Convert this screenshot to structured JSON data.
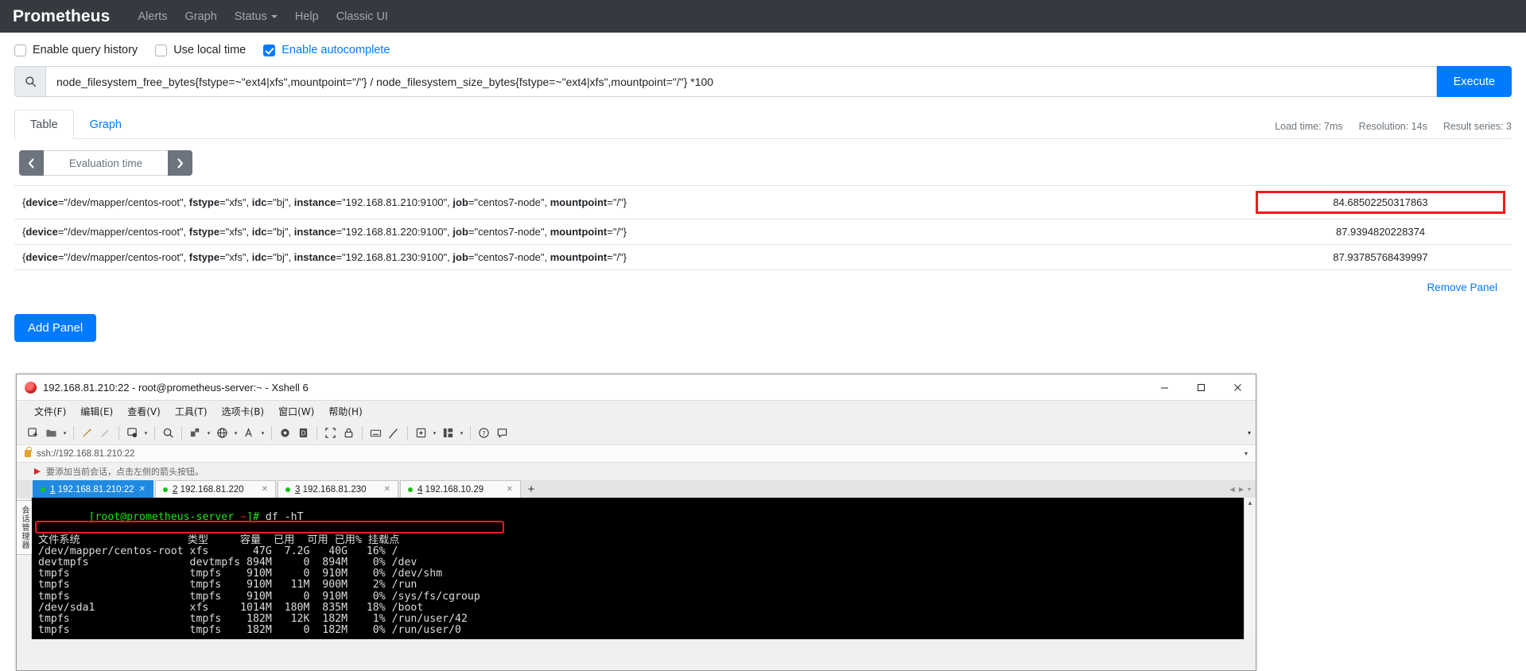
{
  "navbar": {
    "brand": "Prometheus",
    "links": [
      {
        "label": "Alerts"
      },
      {
        "label": "Graph"
      },
      {
        "label": "Status",
        "caret": true
      },
      {
        "label": "Help"
      },
      {
        "label": "Classic UI"
      }
    ]
  },
  "options": [
    {
      "label": "Enable query history",
      "checked": false
    },
    {
      "label": "Use local time",
      "checked": false
    },
    {
      "label": "Enable autocomplete",
      "checked": true
    }
  ],
  "query": {
    "icon": "search-icon",
    "expression": "node_filesystem_free_bytes{fstype=~\"ext4|xfs\",mountpoint=\"/\"} / node_filesystem_size_bytes{fstype=~\"ext4|xfs\",mountpoint=\"/\"} *100",
    "execute_label": "Execute"
  },
  "tabs": [
    {
      "label": "Table",
      "active": true
    },
    {
      "label": "Graph",
      "active": false
    }
  ],
  "stats": {
    "load_time": "Load time: 7ms",
    "resolution": "Resolution: 14s",
    "result_series": "Result series: 3"
  },
  "evaluation": {
    "prev_icon": "chevron-left-icon",
    "next_icon": "chevron-right-icon",
    "placeholder": "Evaluation time"
  },
  "results": [
    {
      "labels": [
        {
          "key": "device",
          "value": "\"/dev/mapper/centos-root\""
        },
        {
          "key": "fstype",
          "value": "\"xfs\""
        },
        {
          "key": "idc",
          "value": "\"bj\""
        },
        {
          "key": "instance",
          "value": "\"192.168.81.210:9100\""
        },
        {
          "key": "job",
          "value": "\"centos7-node\""
        },
        {
          "key": "mountpoint",
          "value": "\"/\""
        }
      ],
      "value": "84.68502250317863",
      "highlighted": true
    },
    {
      "labels": [
        {
          "key": "device",
          "value": "\"/dev/mapper/centos-root\""
        },
        {
          "key": "fstype",
          "value": "\"xfs\""
        },
        {
          "key": "idc",
          "value": "\"bj\""
        },
        {
          "key": "instance",
          "value": "\"192.168.81.220:9100\""
        },
        {
          "key": "job",
          "value": "\"centos7-node\""
        },
        {
          "key": "mountpoint",
          "value": "\"/\""
        }
      ],
      "value": "87.9394820228374",
      "highlighted": false
    },
    {
      "labels": [
        {
          "key": "device",
          "value": "\"/dev/mapper/centos-root\""
        },
        {
          "key": "fstype",
          "value": "\"xfs\""
        },
        {
          "key": "idc",
          "value": "\"bj\""
        },
        {
          "key": "instance",
          "value": "\"192.168.81.230:9100\""
        },
        {
          "key": "job",
          "value": "\"centos7-node\""
        },
        {
          "key": "mountpoint",
          "value": "\"/\""
        }
      ],
      "value": "87.93785768439997",
      "highlighted": false
    }
  ],
  "panel_actions": {
    "remove_panel": "Remove Panel",
    "add_panel": "Add Panel"
  },
  "colors": {
    "brand_blue": "#007bff",
    "navbar_dark": "#343a40",
    "highlight_red": "#f01b1b",
    "terminal_green": "#19e619"
  },
  "xshell": {
    "title": "192.168.81.210:22 - root@prometheus-server:~ - Xshell 6",
    "logo": "xshell-logo-icon",
    "window_buttons": [
      {
        "icon": "minimize-icon",
        "glyph": "—"
      },
      {
        "icon": "maximize-icon",
        "glyph": "□"
      },
      {
        "icon": "close-icon",
        "glyph": "✕"
      }
    ],
    "menus": [
      "文件(F)",
      "编辑(E)",
      "查看(V)",
      "工具(T)",
      "选项卡(B)",
      "窗口(W)",
      "帮助(H)"
    ],
    "toolbar_icons": [
      "new-session-icon",
      "open-folder-icon",
      "folder-dropdown-icon",
      "separator",
      "highlight-pen-icon",
      "clear-pen-icon",
      "separator",
      "session-properties-icon",
      "properties-dropdown-icon",
      "separator",
      "find-icon",
      "separator",
      "file-transfer-icon",
      "transfer-dropdown-icon",
      "globe-icon",
      "globe-dropdown-icon",
      "font-icon",
      "font-dropdown-icon",
      "separator",
      "send-key-icon",
      "log-icon",
      "separator",
      "fullscreen-icon",
      "lock-icon",
      "separator",
      "keyboard-icon",
      "compose-icon",
      "separator",
      "add-panel-icon",
      "add-panel-dropdown-icon",
      "layout-icon",
      "layout-dropdown-icon",
      "separator",
      "help-icon",
      "comment-icon"
    ],
    "address": {
      "lock_icon": "lock-icon",
      "url": "ssh://192.168.81.210:22",
      "caret": "chevron-down-icon"
    },
    "bookmark_hint": {
      "icon": "red-flag-icon",
      "text": "要添加当前会话，点击左侧的箭头按钮。"
    },
    "session_tabs": [
      {
        "num": "1",
        "label": "192.168.81.210:22",
        "active": true
      },
      {
        "num": "2",
        "label": "192.168.81.220",
        "active": false
      },
      {
        "num": "3",
        "label": "192.168.81.230",
        "active": false
      },
      {
        "num": "4",
        "label": "192.168.10.29",
        "active": false
      }
    ],
    "new_tab_label": "+",
    "side_panel_label": "会话管理器",
    "terminal": {
      "prompt_user": "[root@prometheus-server",
      "prompt_path": "~",
      "prompt_end": "]#",
      "command": " df -hT",
      "header": "文件系统                 类型     容量  已用  可用 已用% 挂载点",
      "rows": [
        {
          "text": "/dev/mapper/centos-root xfs       47G  7.2G   40G   16% /",
          "highlighted": true
        },
        {
          "text": "devtmpfs                devtmpfs 894M     0  894M    0% /dev",
          "highlighted": false
        },
        {
          "text": "tmpfs                   tmpfs    910M     0  910M    0% /dev/shm",
          "highlighted": false
        },
        {
          "text": "tmpfs                   tmpfs    910M   11M  900M    2% /run",
          "highlighted": false
        },
        {
          "text": "tmpfs                   tmpfs    910M     0  910M    0% /sys/fs/cgroup",
          "highlighted": false
        },
        {
          "text": "/dev/sda1               xfs     1014M  180M  835M   18% /boot",
          "highlighted": false
        },
        {
          "text": "tmpfs                   tmpfs    182M   12K  182M    1% /run/user/42",
          "highlighted": false
        },
        {
          "text": "tmpfs                   tmpfs    182M     0  182M    0% /run/user/0",
          "highlighted": false
        }
      ]
    }
  }
}
